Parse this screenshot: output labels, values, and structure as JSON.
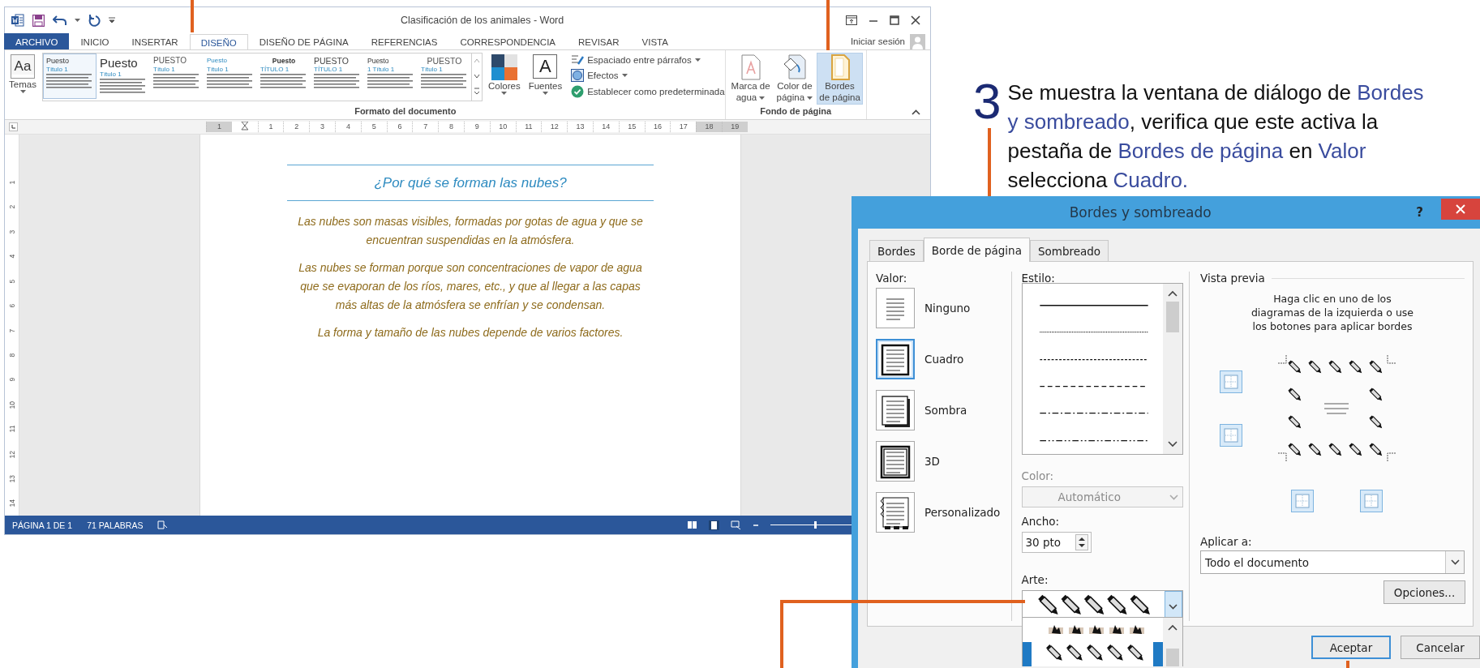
{
  "word_window": {
    "title": "Clasificación de los animales - Word",
    "tabs": [
      {
        "label": "ARCHIVO",
        "kind": "file",
        "selected": false
      },
      {
        "label": "INICIO",
        "kind": "tab",
        "selected": false
      },
      {
        "label": "INSERTAR",
        "kind": "tab",
        "selected": false
      },
      {
        "label": "DISEÑO",
        "kind": "tab",
        "selected": true
      },
      {
        "label": "DISEÑO DE PÁGINA",
        "kind": "tab",
        "selected": false
      },
      {
        "label": "REFERENCIAS",
        "kind": "tab",
        "selected": false
      },
      {
        "label": "CORRESPONDENCIA",
        "kind": "tab",
        "selected": false
      },
      {
        "label": "REVISAR",
        "kind": "tab",
        "selected": false
      },
      {
        "label": "VISTA",
        "kind": "tab",
        "selected": false
      }
    ],
    "sign_in": "Iniciar sesión",
    "themes": {
      "label": "Temas",
      "icon_text": "Aa"
    },
    "style_gallery": [
      {
        "title": "Puesto",
        "subtitle": "Título 1",
        "kind": "compact",
        "selected": true
      },
      {
        "title": "Puesto",
        "subtitle": "Título 1",
        "kind": "large",
        "selected": false
      },
      {
        "title": "PUESTO",
        "subtitle": "Título 1",
        "kind": "caps-light",
        "selected": false
      },
      {
        "title": "Puesto",
        "subtitle": "Título 1",
        "kind": "blue",
        "selected": false
      },
      {
        "title": "Puesto",
        "subtitle": "TÍTULO 1",
        "kind": "bold",
        "selected": false
      },
      {
        "title": "PUESTO",
        "subtitle": "TÍTULO 1",
        "kind": "caps",
        "selected": false
      },
      {
        "title": "Puesto",
        "subtitle": "1 Título 1",
        "kind": "numbered",
        "selected": false
      },
      {
        "title": "PUESTO",
        "subtitle": "Título 1",
        "kind": "caps-centered",
        "selected": false
      }
    ],
    "colors": {
      "label": "Colores"
    },
    "fonts": {
      "label": "Fuentes",
      "icon_text": "A"
    },
    "format_commands": [
      {
        "label": "Espaciado entre párrafos",
        "kind": "spacing",
        "dropdown": true
      },
      {
        "label": "Efectos",
        "kind": "effects",
        "dropdown": true
      },
      {
        "label": "Establecer como predeterminada",
        "kind": "set-default",
        "dropdown": false
      }
    ],
    "format_group": "Formato del documento",
    "background_commands": [
      {
        "lines": [
          "Marca de",
          "agua"
        ],
        "kind": "watermark",
        "dropdown": true,
        "selected": false
      },
      {
        "lines": [
          "Color de",
          "página"
        ],
        "kind": "page-color",
        "dropdown": true,
        "selected": false
      },
      {
        "lines": [
          "Bordes",
          "de página"
        ],
        "kind": "page-borders",
        "dropdown": false,
        "selected": true
      }
    ],
    "background_group": "Fondo de página",
    "ruler_marks": [
      {
        "label": "1",
        "margin": true
      },
      {
        "label": "1",
        "margin": false
      },
      {
        "label": "2",
        "margin": false
      },
      {
        "label": "3",
        "margin": false
      },
      {
        "label": "4",
        "margin": false
      },
      {
        "label": "5",
        "margin": false
      },
      {
        "label": "6",
        "margin": false
      },
      {
        "label": "7",
        "margin": false
      },
      {
        "label": "8",
        "margin": false
      },
      {
        "label": "9",
        "margin": false
      },
      {
        "label": "10",
        "margin": false
      },
      {
        "label": "11",
        "margin": false
      },
      {
        "label": "12",
        "margin": false
      },
      {
        "label": "13",
        "margin": false
      },
      {
        "label": "14",
        "margin": false
      },
      {
        "label": "15",
        "margin": false
      },
      {
        "label": "16",
        "margin": false
      },
      {
        "label": "17",
        "margin": false
      },
      {
        "label": "18",
        "margin": true
      },
      {
        "label": "19",
        "margin": true
      }
    ],
    "vertical_ruler_marks": [
      "1",
      "2",
      "3",
      "4",
      "5",
      "6",
      "7",
      "8",
      "9",
      "10",
      "11",
      "12",
      "13",
      "14"
    ],
    "document": {
      "heading": "¿Por qué se forman las nubes?",
      "paragraphs": [
        "Las nubes son masas visibles, formadas por gotas de agua y que se encuentran suspendidas en la atmósfera.",
        "Las nubes se forman porque son concentraciones de vapor de agua que se evaporan de los ríos, mares, etc., y que al llegar a las capas más altas de la atmósfera se enfrían y se condensan.",
        "La forma y tamaño de las nubes depende de varios factores."
      ]
    },
    "status_bar": {
      "page": "PÁGINA 1 DE 1",
      "words": "71 PALABRAS",
      "zoom": {
        "level": 0.45
      }
    }
  },
  "instruction": {
    "number": "3",
    "text": "Se muestra la ventana de diálogo de *Bordes y sombreado*, verifica que este activa la pestaña de *Bordes de página* en *Valor* selecciona *Cuadro.*"
  },
  "dialog": {
    "title": "Bordes y sombreado",
    "help": "?",
    "tabs": [
      {
        "label": "Bordes",
        "selected": false
      },
      {
        "label": "Borde de página",
        "selected": true
      },
      {
        "label": "Sombreado",
        "selected": false
      }
    ],
    "setting_label": "Valor:",
    "settings": [
      {
        "label": "Ninguno",
        "kind": "none",
        "selected": false
      },
      {
        "label": "Cuadro",
        "kind": "box",
        "selected": true
      },
      {
        "label": "Sombra",
        "kind": "shadow",
        "selected": false
      },
      {
        "label": "3D",
        "kind": "threed",
        "selected": false
      },
      {
        "label": "Personalizado",
        "kind": "custom",
        "selected": false
      }
    ],
    "style_label": "Estilo:",
    "styles": [
      {
        "kind": "solid"
      },
      {
        "kind": "dotted"
      },
      {
        "kind": "dashed-short"
      },
      {
        "kind": "dashed"
      },
      {
        "kind": "dash-dot"
      },
      {
        "kind": "dash-dot-dot"
      }
    ],
    "color_label": "Color:",
    "color_value": "Automático",
    "color_disabled": true,
    "width_label": "Ancho:",
    "width_value": "30 pto",
    "art_label": "Arte:",
    "art_value": {
      "kind": "pencils"
    },
    "art_options": [
      {
        "kind": "figures",
        "selected": false
      },
      {
        "kind": "pencils",
        "selected": true
      }
    ],
    "preview_label": "Vista previa",
    "preview_hint": "Haga clic en uno de los diagramas de la izquierda o use los botones para aplicar bordes",
    "apply_label": "Aplicar a:",
    "apply_value": "Todo el documento",
    "options_button": "Opciones...",
    "ok_button": "Aceptar",
    "cancel_button": "Cancelar"
  }
}
